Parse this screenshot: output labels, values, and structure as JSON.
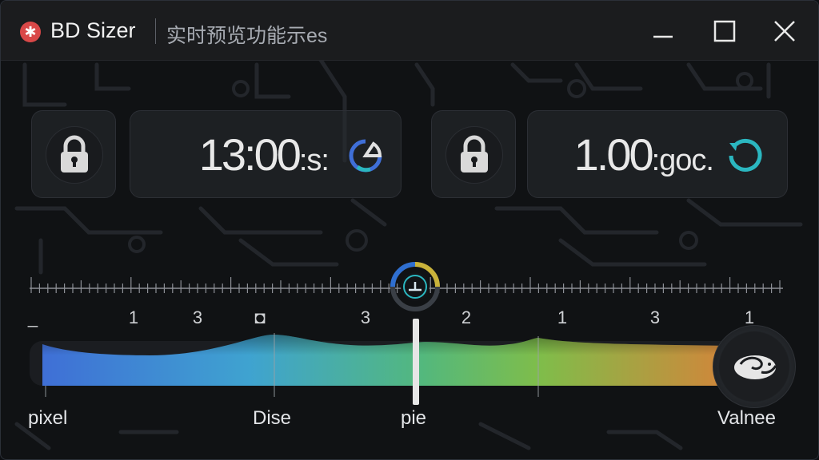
{
  "window": {
    "app_name": "BD Sizer",
    "subtitle": "实时预览功能示es",
    "icon_glyph": "✱",
    "controls": [
      "minimize-icon",
      "maximize-icon",
      "close-icon"
    ]
  },
  "panels": [
    {
      "value": "13:00",
      "unit": ":s:",
      "locked": true,
      "action_icon": "refresh-icon",
      "action_color": "#3f6fd8"
    },
    {
      "value": "1.00",
      "unit": ":goc.",
      "locked": true,
      "action_icon": "reset-icon",
      "action_color": "#2bb7c0"
    }
  ],
  "ruler": {
    "tick_labels": [
      "_",
      "1",
      "3",
      "◘",
      "3",
      "2",
      "1",
      "3",
      "1"
    ]
  },
  "slider": {
    "position_label": "pie",
    "labels": [
      "pixel",
      "Dise",
      "pie",
      "Valnee"
    ],
    "gradient_colors": [
      "#3f6fd6",
      "#3fa3d0",
      "#53b87d",
      "#7fbd4a",
      "#d4843a"
    ]
  }
}
